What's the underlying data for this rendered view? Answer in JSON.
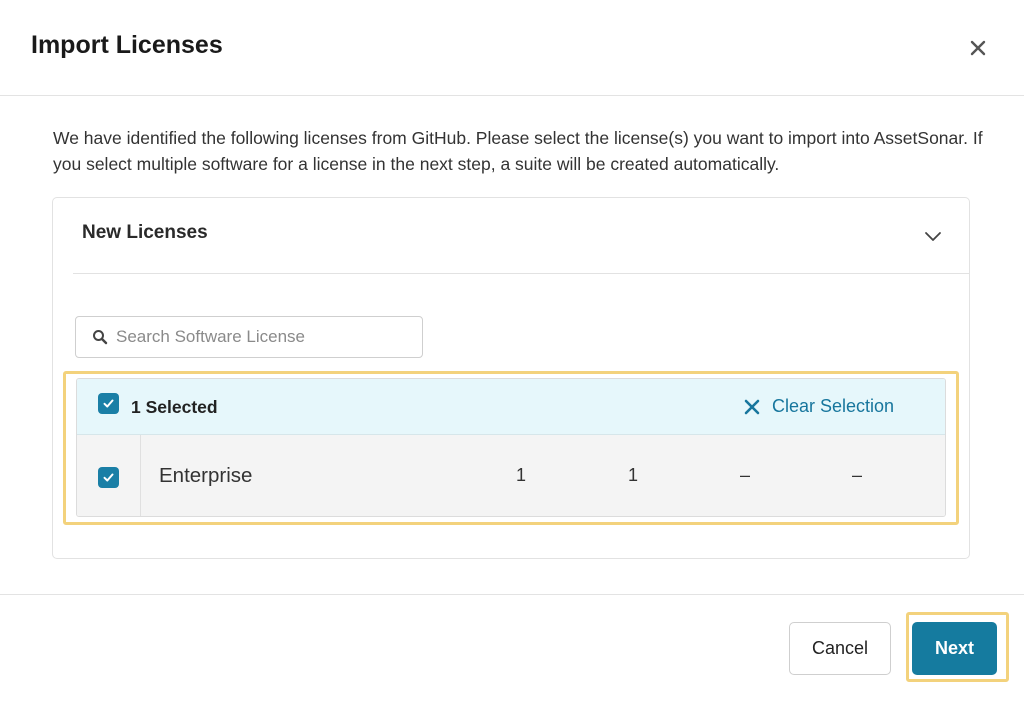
{
  "dialog": {
    "title": "Import Licenses",
    "description": "We have identified the following licenses from GitHub. Please select the license(s) you want to import into AssetSonar. If you select multiple software for a license in the next step, a suite will be created automatically."
  },
  "panel": {
    "title": "New Licenses",
    "search": {
      "placeholder": "Search Software License",
      "value": ""
    },
    "selection": {
      "label": "1 Selected",
      "clear_label": "Clear Selection"
    },
    "rows": [
      {
        "name": "Enterprise",
        "cols": [
          "1",
          "1",
          "–",
          "–"
        ],
        "checked": true
      }
    ]
  },
  "footer": {
    "cancel_label": "Cancel",
    "next_label": "Next"
  },
  "colors": {
    "accent": "#157b9f",
    "highlight": "#f3d27c",
    "selected_row_bg": "#e6f7fb"
  },
  "icons": [
    "close-icon",
    "chevron-down-icon",
    "search-icon",
    "checkbox-checked-icon",
    "clear-x-icon"
  ]
}
